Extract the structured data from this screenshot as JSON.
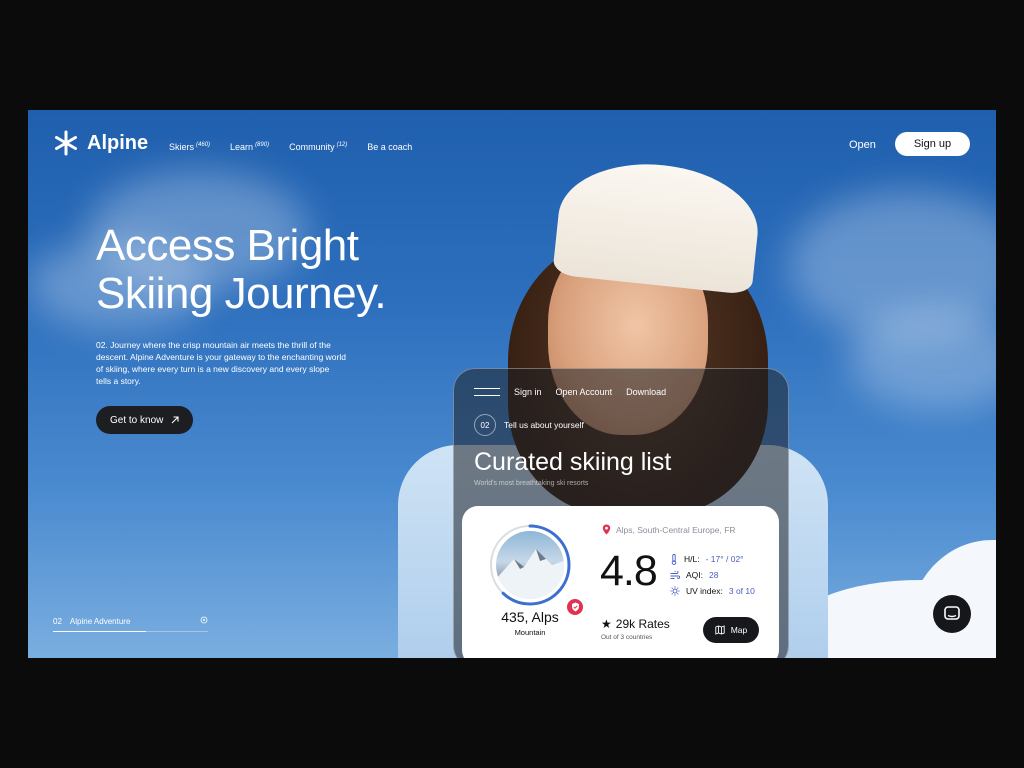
{
  "brand": {
    "name": "Alpine"
  },
  "nav": {
    "items": [
      {
        "label": "Skiers",
        "count": "(460)"
      },
      {
        "label": "Learn",
        "count": "(890)"
      },
      {
        "label": "Community",
        "count": "(12)"
      },
      {
        "label": "Be a coach",
        "count": ""
      }
    ],
    "open_label": "Open",
    "signup_label": "Sign up"
  },
  "hero": {
    "headline_line1": "Access Bright",
    "headline_line2": "Skiing Journey.",
    "description": "02. Journey where the crisp mountain air meets the thrill of the descent. Alpine Adventure is your gateway to the enchanting world of skiing, where every turn is a new discovery and every slope tells a story.",
    "cta_label": "Get to know"
  },
  "slide_indicator": {
    "number": "02",
    "label": "Alpine Adventure",
    "progress": 0.6
  },
  "panel": {
    "nav": [
      "Sign in",
      "Open Account",
      "Download"
    ],
    "step_number": "02",
    "step_label": "Tell us about yourself",
    "title": "Curated skiing list",
    "subtitle": "World's most breathtaking ski resorts"
  },
  "card": {
    "name": "435, Alps",
    "type": "Mountain",
    "location": "Alps, South-Central Europe, FR",
    "rating": "4.8",
    "ring_fill": 0.62,
    "stats": [
      {
        "icon": "thermometer-icon",
        "label": "H/L:",
        "value": "- 17° / 02°"
      },
      {
        "icon": "wind-icon",
        "label": "AQI:",
        "value": "28"
      },
      {
        "icon": "sun-icon",
        "label": "UV index:",
        "value": "3 of 10"
      }
    ],
    "rates": "29k Rates",
    "rates_sub": "Out of 3 countries",
    "map_label": "Map"
  },
  "colors": {
    "accent_red": "#e0334f",
    "stat_blue": "#4a5ec0",
    "dark": "#16181c"
  }
}
